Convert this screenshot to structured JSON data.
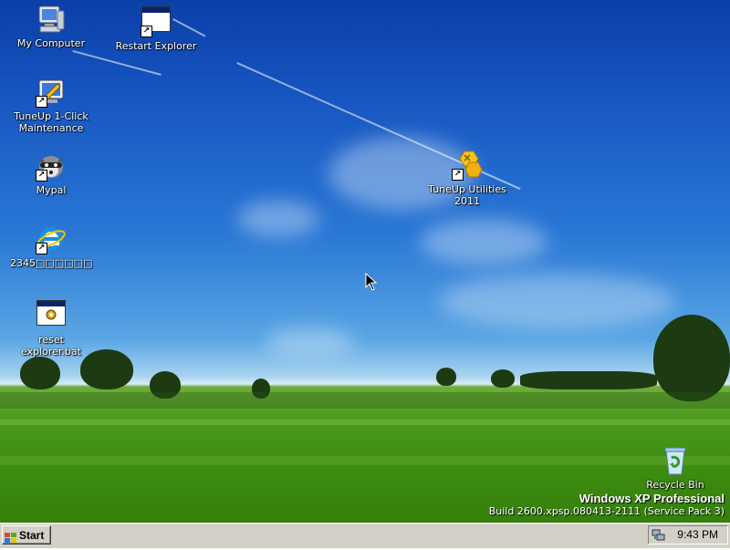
{
  "desktop": {
    "icons": [
      {
        "label": "My Computer",
        "icon": "my-computer-icon"
      },
      {
        "label": "Restart Explorer",
        "icon": "batch-window-icon"
      },
      {
        "label": "TuneUp 1-Click\nMaintenance",
        "icon": "tuneup-maintenance-icon"
      },
      {
        "label": "Mypal",
        "icon": "mypal-raccoon-icon"
      },
      {
        "label": "2345□□□□□□",
        "icon": "ie-browser-icon"
      },
      {
        "label": "reset explorer.bat",
        "icon": "batch-gear-icon"
      },
      {
        "label": "TuneUp Utilities 2011",
        "icon": "tuneup-utilities-icon"
      },
      {
        "label": "Recycle Bin",
        "icon": "recycle-bin-icon"
      }
    ],
    "shortcut_arrow": "↗",
    "brand": {
      "title": "Windows XP Professional",
      "build": "Build 2600.xpsp.080413-2111 (Service Pack 3)"
    }
  },
  "taskbar": {
    "start_label": "Start",
    "clock": "9:43 PM",
    "tray_icon": "network-tray-icon"
  },
  "colors": {
    "sky_top": "#0b3fa8",
    "grass": "#4c9a1e",
    "taskbar": "#d4d0c8"
  }
}
